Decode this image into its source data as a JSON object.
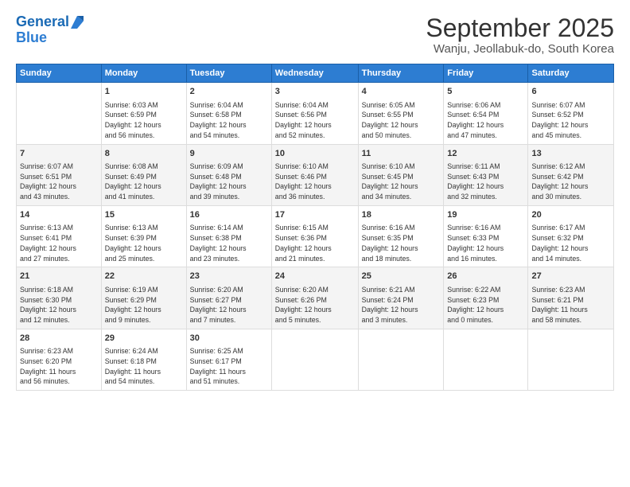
{
  "logo": {
    "line1": "General",
    "line2": "Blue"
  },
  "title": "September 2025",
  "subtitle": "Wanju, Jeollabuk-do, South Korea",
  "weekdays": [
    "Sunday",
    "Monday",
    "Tuesday",
    "Wednesday",
    "Thursday",
    "Friday",
    "Saturday"
  ],
  "weeks": [
    [
      {
        "day": "",
        "text": ""
      },
      {
        "day": "1",
        "text": "Sunrise: 6:03 AM\nSunset: 6:59 PM\nDaylight: 12 hours\nand 56 minutes."
      },
      {
        "day": "2",
        "text": "Sunrise: 6:04 AM\nSunset: 6:58 PM\nDaylight: 12 hours\nand 54 minutes."
      },
      {
        "day": "3",
        "text": "Sunrise: 6:04 AM\nSunset: 6:56 PM\nDaylight: 12 hours\nand 52 minutes."
      },
      {
        "day": "4",
        "text": "Sunrise: 6:05 AM\nSunset: 6:55 PM\nDaylight: 12 hours\nand 50 minutes."
      },
      {
        "day": "5",
        "text": "Sunrise: 6:06 AM\nSunset: 6:54 PM\nDaylight: 12 hours\nand 47 minutes."
      },
      {
        "day": "6",
        "text": "Sunrise: 6:07 AM\nSunset: 6:52 PM\nDaylight: 12 hours\nand 45 minutes."
      }
    ],
    [
      {
        "day": "7",
        "text": "Sunrise: 6:07 AM\nSunset: 6:51 PM\nDaylight: 12 hours\nand 43 minutes."
      },
      {
        "day": "8",
        "text": "Sunrise: 6:08 AM\nSunset: 6:49 PM\nDaylight: 12 hours\nand 41 minutes."
      },
      {
        "day": "9",
        "text": "Sunrise: 6:09 AM\nSunset: 6:48 PM\nDaylight: 12 hours\nand 39 minutes."
      },
      {
        "day": "10",
        "text": "Sunrise: 6:10 AM\nSunset: 6:46 PM\nDaylight: 12 hours\nand 36 minutes."
      },
      {
        "day": "11",
        "text": "Sunrise: 6:10 AM\nSunset: 6:45 PM\nDaylight: 12 hours\nand 34 minutes."
      },
      {
        "day": "12",
        "text": "Sunrise: 6:11 AM\nSunset: 6:43 PM\nDaylight: 12 hours\nand 32 minutes."
      },
      {
        "day": "13",
        "text": "Sunrise: 6:12 AM\nSunset: 6:42 PM\nDaylight: 12 hours\nand 30 minutes."
      }
    ],
    [
      {
        "day": "14",
        "text": "Sunrise: 6:13 AM\nSunset: 6:41 PM\nDaylight: 12 hours\nand 27 minutes."
      },
      {
        "day": "15",
        "text": "Sunrise: 6:13 AM\nSunset: 6:39 PM\nDaylight: 12 hours\nand 25 minutes."
      },
      {
        "day": "16",
        "text": "Sunrise: 6:14 AM\nSunset: 6:38 PM\nDaylight: 12 hours\nand 23 minutes."
      },
      {
        "day": "17",
        "text": "Sunrise: 6:15 AM\nSunset: 6:36 PM\nDaylight: 12 hours\nand 21 minutes."
      },
      {
        "day": "18",
        "text": "Sunrise: 6:16 AM\nSunset: 6:35 PM\nDaylight: 12 hours\nand 18 minutes."
      },
      {
        "day": "19",
        "text": "Sunrise: 6:16 AM\nSunset: 6:33 PM\nDaylight: 12 hours\nand 16 minutes."
      },
      {
        "day": "20",
        "text": "Sunrise: 6:17 AM\nSunset: 6:32 PM\nDaylight: 12 hours\nand 14 minutes."
      }
    ],
    [
      {
        "day": "21",
        "text": "Sunrise: 6:18 AM\nSunset: 6:30 PM\nDaylight: 12 hours\nand 12 minutes."
      },
      {
        "day": "22",
        "text": "Sunrise: 6:19 AM\nSunset: 6:29 PM\nDaylight: 12 hours\nand 9 minutes."
      },
      {
        "day": "23",
        "text": "Sunrise: 6:20 AM\nSunset: 6:27 PM\nDaylight: 12 hours\nand 7 minutes."
      },
      {
        "day": "24",
        "text": "Sunrise: 6:20 AM\nSunset: 6:26 PM\nDaylight: 12 hours\nand 5 minutes."
      },
      {
        "day": "25",
        "text": "Sunrise: 6:21 AM\nSunset: 6:24 PM\nDaylight: 12 hours\nand 3 minutes."
      },
      {
        "day": "26",
        "text": "Sunrise: 6:22 AM\nSunset: 6:23 PM\nDaylight: 12 hours\nand 0 minutes."
      },
      {
        "day": "27",
        "text": "Sunrise: 6:23 AM\nSunset: 6:21 PM\nDaylight: 11 hours\nand 58 minutes."
      }
    ],
    [
      {
        "day": "28",
        "text": "Sunrise: 6:23 AM\nSunset: 6:20 PM\nDaylight: 11 hours\nand 56 minutes."
      },
      {
        "day": "29",
        "text": "Sunrise: 6:24 AM\nSunset: 6:18 PM\nDaylight: 11 hours\nand 54 minutes."
      },
      {
        "day": "30",
        "text": "Sunrise: 6:25 AM\nSunset: 6:17 PM\nDaylight: 11 hours\nand 51 minutes."
      },
      {
        "day": "",
        "text": ""
      },
      {
        "day": "",
        "text": ""
      },
      {
        "day": "",
        "text": ""
      },
      {
        "day": "",
        "text": ""
      }
    ]
  ]
}
